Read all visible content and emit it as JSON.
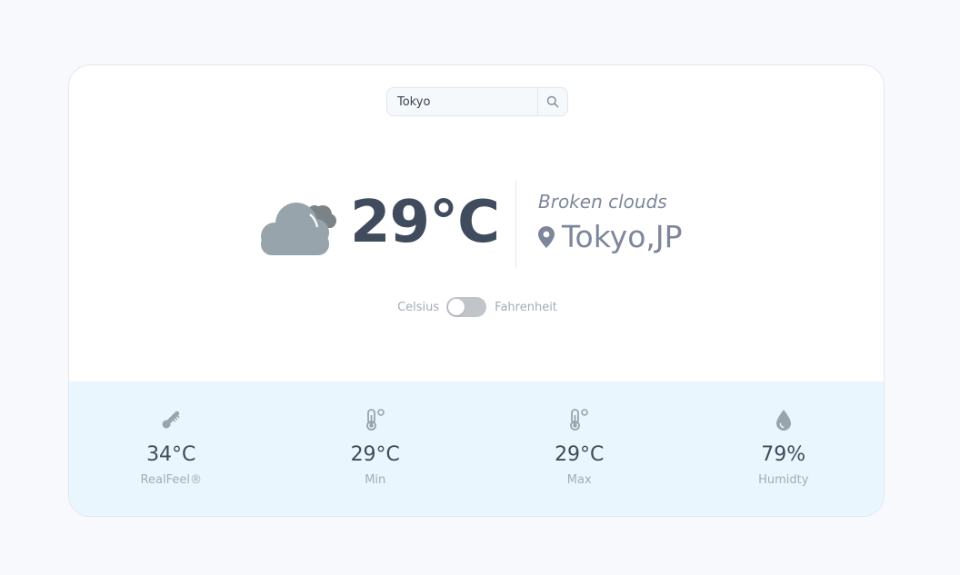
{
  "search": {
    "value": "Tokyo",
    "icon": "search-icon"
  },
  "current": {
    "icon": "broken-clouds-icon",
    "temperature": "29°C",
    "description": "Broken clouds",
    "location": "Tokyo,JP",
    "location_icon": "map-pin-icon"
  },
  "unit_toggle": {
    "left_label": "Celsius",
    "right_label": "Fahrenheit",
    "state": "celsius"
  },
  "stats": [
    {
      "icon": "thermometer-tilted-icon",
      "value": "34°C",
      "label": "RealFeel®"
    },
    {
      "icon": "thermometer-degree-icon",
      "value": "29°C",
      "label": "Min"
    },
    {
      "icon": "thermometer-degree-icon",
      "value": "29°C",
      "label": "Max"
    },
    {
      "icon": "water-drop-icon",
      "value": "79%",
      "label": "Humidty"
    }
  ],
  "colors": {
    "page_bg": "#f7f9fd",
    "card_bg": "#ffffff",
    "stats_bg": "#e9f6fd",
    "temp_text": "#414b5e",
    "muted_text": "#7d8799",
    "icon_gray": "#98a4ae"
  }
}
